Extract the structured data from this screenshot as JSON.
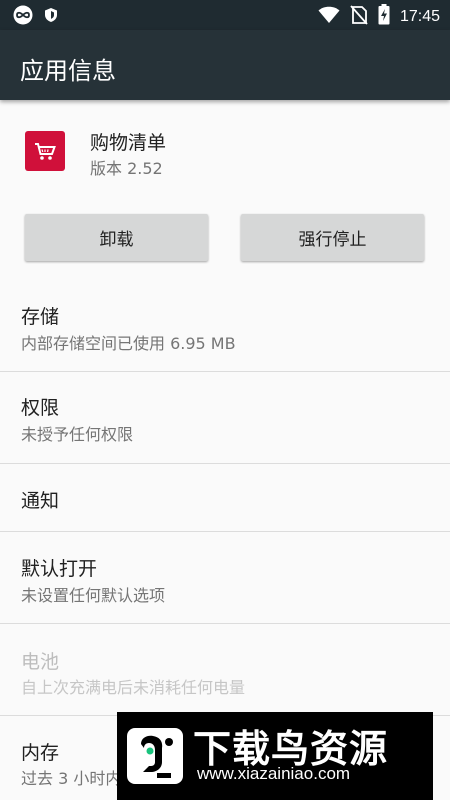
{
  "status_bar": {
    "time": "17:45",
    "left_icons": [
      "infinity-icon",
      "shield-icon"
    ],
    "right_icons": [
      "wifi-icon",
      "no-sim-icon",
      "battery-charging-icon"
    ]
  },
  "app_bar": {
    "title": "应用信息"
  },
  "app": {
    "name": "购物清单",
    "version": "版本 2.52",
    "icon": "shopping-cart-icon",
    "icon_color": "#d0103a"
  },
  "buttons": {
    "uninstall": "卸载",
    "force_stop": "强行停止"
  },
  "settings": [
    {
      "title": "存储",
      "summary": "内部存储空间已使用 6.95 MB",
      "enabled": true
    },
    {
      "title": "权限",
      "summary": "未授予任何权限",
      "enabled": true
    },
    {
      "title": "通知",
      "summary": "",
      "enabled": true
    },
    {
      "title": "默认打开",
      "summary": "未设置任何默认选项",
      "enabled": true
    },
    {
      "title": "电池",
      "summary": "自上次充满电后未消耗任何电量",
      "enabled": false
    },
    {
      "title": "内存",
      "summary": "过去 3 小时内",
      "enabled": true
    }
  ],
  "watermark": {
    "title": "下载鸟资源",
    "url": "www.xiazainiao.com"
  },
  "colors": {
    "app_bar": "#263238",
    "status_bar": "#1f2b31",
    "button": "#d6d7d7",
    "accent": "#d0103a"
  }
}
